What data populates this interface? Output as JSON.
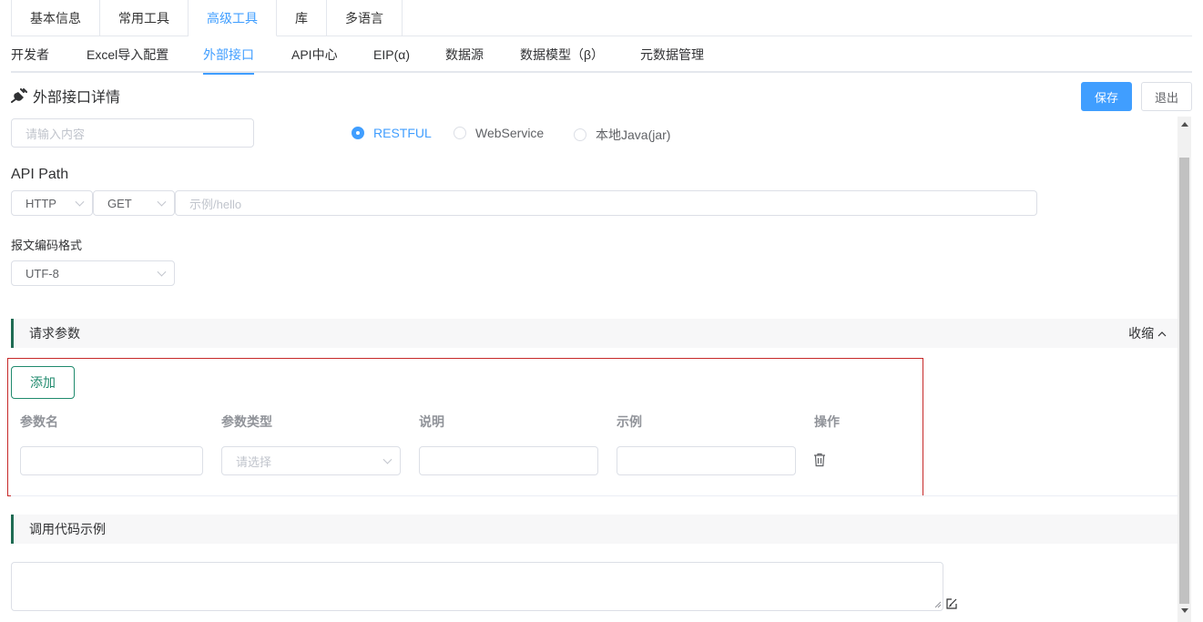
{
  "top_tabs": [
    "基本信息",
    "常用工具",
    "高级工具",
    "库",
    "多语言"
  ],
  "top_tab_active": "高级工具",
  "sub_tabs": [
    "开发者",
    "Excel导入配置",
    "外部接口",
    "API中心",
    "EIP(α)",
    "数据源",
    "数据模型（β）",
    "元数据管理"
  ],
  "sub_tab_active": "外部接口",
  "header": {
    "title": "外部接口详情",
    "save_label": "保存",
    "exit_label": "退出"
  },
  "form": {
    "name_placeholder": "请输入内容",
    "radios": [
      "RESTFUL",
      "WebService",
      "本地Java(jar)"
    ],
    "radio_selected": "RESTFUL",
    "api_path_label": "API Path",
    "protocol": "HTTP",
    "method": "GET",
    "path_placeholder": "示例/hello",
    "encoding_label": "报文编码格式",
    "encoding": "UTF-8"
  },
  "request_params": {
    "title": "请求参数",
    "collapse_label": "收缩",
    "add_label": "添加",
    "columns": [
      "参数名",
      "参数类型",
      "说明",
      "示例",
      "操作"
    ],
    "type_placeholder": "请选择"
  },
  "code_example": {
    "title": "调用代码示例"
  },
  "colors": {
    "primary": "#409eff",
    "accent_green": "#1f8a6d",
    "highlight_red": "#c62828"
  },
  "icons": [
    "plug-icon",
    "chevron-down-icon",
    "chevron-up-icon",
    "trash-icon",
    "edit-icon"
  ]
}
